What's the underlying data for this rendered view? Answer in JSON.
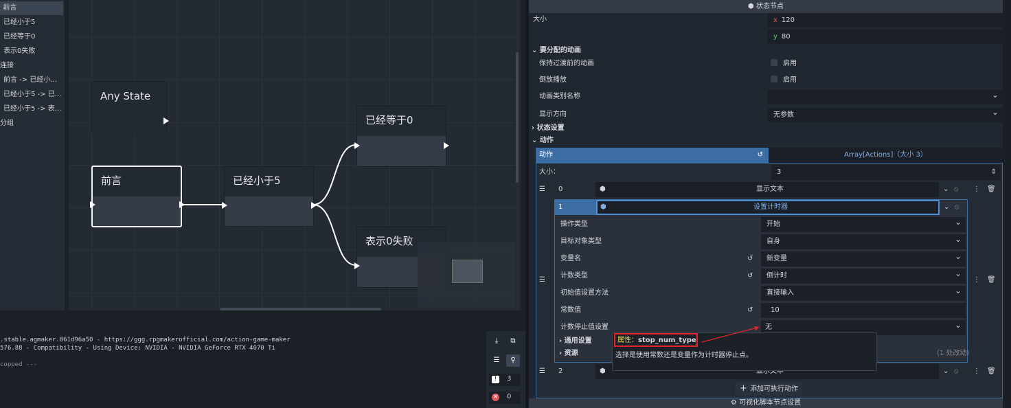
{
  "tree": {
    "items": [
      "前言",
      "已经小于5",
      "已经等于0",
      "表示0失败",
      "连接",
      "前言 -> 已经小...",
      "已经小于5 -> 已...",
      "已经小于5 -> 表...",
      "分组"
    ]
  },
  "graph": {
    "nodes": {
      "any_state": "Any State",
      "intro": "前言",
      "less5": "已经小于5",
      "eq0": "已经等于0",
      "fail0": "表示0失败"
    }
  },
  "console": {
    "lines": [
      ".stable.agmaker.861d96a50 - https://ggg.rpgmakerofficial.com/action-game-maker",
      "576.88 - Compatibility - Using Device: NVIDIA - NVIDIA GeForce RTX 4070 Ti",
      "copped ---"
    ],
    "warnings": "3",
    "errors": "0"
  },
  "inspector": {
    "header": "状态节点",
    "size_label": "大小",
    "size_x_axis": "x",
    "size_x": "120",
    "size_y_axis": "y",
    "size_y": "80",
    "anim_section": "要分配的动画",
    "keep_anim": "保持过渡前的动画",
    "reverse": "倒放播放",
    "enable": "启用",
    "anim_category": "动画类别名称",
    "display_dir": "显示方向",
    "no_param": "无参数",
    "state_settings": "状态设置",
    "actions_section": "动作",
    "actions_label": "动作",
    "array_value": "Array[Actions]（大小 3）",
    "array_size_label": "大小：",
    "array_size": "3",
    "items": [
      {
        "index": "0",
        "name": "显示文本"
      },
      {
        "index": "1",
        "name": "设置计时器"
      },
      {
        "index": "2",
        "name": "显示文本"
      }
    ],
    "props": [
      {
        "label": "操作类型",
        "value": "开始"
      },
      {
        "label": "目标对象类型",
        "value": "自身"
      },
      {
        "label": "变量名",
        "value": "新变量"
      },
      {
        "label": "计数类型",
        "value": "倒计时"
      },
      {
        "label": "初始值设置方法",
        "value": "直接输入"
      },
      {
        "label": "常数值",
        "value": "10"
      },
      {
        "label": "计数停止值设置",
        "value": "无"
      }
    ],
    "general": "通用设置",
    "resources": "资源",
    "changes": "（1 处改动）",
    "add_action": "添加可执行动作",
    "visual_script": "可视化脚本节点设置"
  },
  "tooltip": {
    "prop_label": "属性：",
    "prop_name": "stop_num_type",
    "desc": "选择是使用常数还是变量作为计时器停止点。"
  },
  "colors": {
    "accent": "#3d6ea3",
    "highlight_box": "#e0262c"
  }
}
